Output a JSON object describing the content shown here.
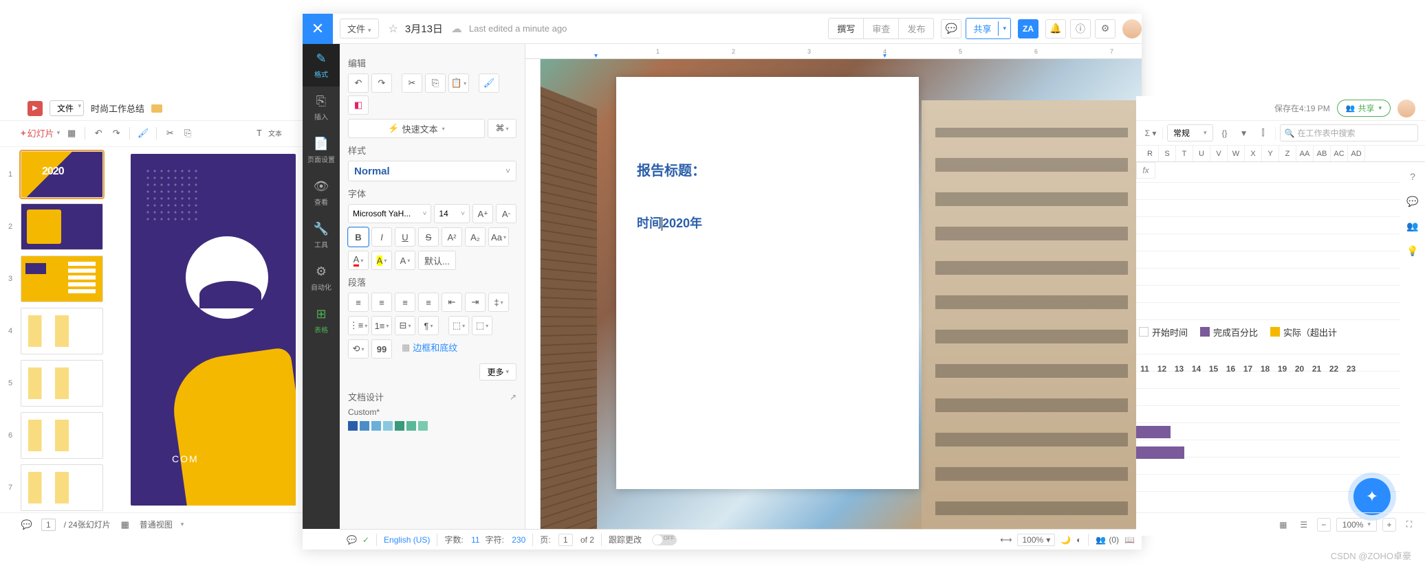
{
  "slides": {
    "file_btn": "文件",
    "title": "时尚工作总结",
    "add_slide": "幻灯片",
    "thumb_count": 7,
    "canvas_text": "COM",
    "bottom": {
      "page_current": "1",
      "page_total_label": "/ 24张幻灯片",
      "view_label": "普通视图"
    }
  },
  "writer": {
    "header": {
      "file_btn": "文件",
      "date": "3月13日",
      "last_edited": "Last edited a minute ago",
      "mode_write": "撰写",
      "mode_review": "审查",
      "mode_publish": "发布",
      "share": "共享",
      "za": "ZA"
    },
    "sidenav": [
      {
        "icon": "✎",
        "label": "格式"
      },
      {
        "icon": "⎘",
        "label": "插入"
      },
      {
        "icon": "📄",
        "label": "页面设置"
      },
      {
        "icon": "👁",
        "label": "查看"
      },
      {
        "icon": "🔧",
        "label": "工具"
      },
      {
        "icon": "⚙",
        "label": "自动化"
      },
      {
        "icon": "⊞",
        "label": "表格"
      }
    ],
    "panel": {
      "h_edit": "编辑",
      "quick_text": "快速文本",
      "h_style": "样式",
      "style_val": "Normal",
      "h_font": "字体",
      "font_family": "Microsoft YaH...",
      "font_size": "14",
      "default_btn": "默认...",
      "h_para": "段落",
      "border_label": "边框和底纹",
      "more": "更多",
      "h_docdesign": "文档设计",
      "custom": "Custom*"
    },
    "page": {
      "h1": "报告标题：",
      "h2_pre": "时间",
      "h2_post": "2020年"
    },
    "ruler_numbers": [
      "1",
      "2",
      "3",
      "4",
      "5",
      "6",
      "7"
    ],
    "status": {
      "lang": "English (US)",
      "words_label": "字数:",
      "words": "11",
      "chars_label": "字符:",
      "chars": "230",
      "page_label": "页:",
      "page_cur": "1",
      "page_of": "of 2",
      "track_label": "跟踪更改",
      "track_state": "OFF",
      "zoom": "100%",
      "collab": "(0)"
    }
  },
  "sheets": {
    "saved_label": "保存在4:19 PM",
    "share": "共享",
    "format_sel": "常规",
    "search_placeholder": "在工作表中搜索",
    "cols": [
      "R",
      "S",
      "T",
      "U",
      "V",
      "W",
      "X",
      "Y",
      "Z",
      "AA",
      "AB",
      "AC",
      "AD"
    ],
    "fx": "fx",
    "legend": [
      {
        "color": "#ffffff",
        "label": "开始时间"
      },
      {
        "color": "#7a5a9a",
        "label": "完成百分比"
      },
      {
        "color": "#f5b800",
        "label": "实际（超出计"
      }
    ],
    "numbers": [
      "11",
      "12",
      "13",
      "14",
      "15",
      "16",
      "17",
      "18",
      "19",
      "20",
      "21",
      "22",
      "23"
    ],
    "zoom": "100%"
  },
  "watermark": "CSDN @ZOHO卓豪"
}
